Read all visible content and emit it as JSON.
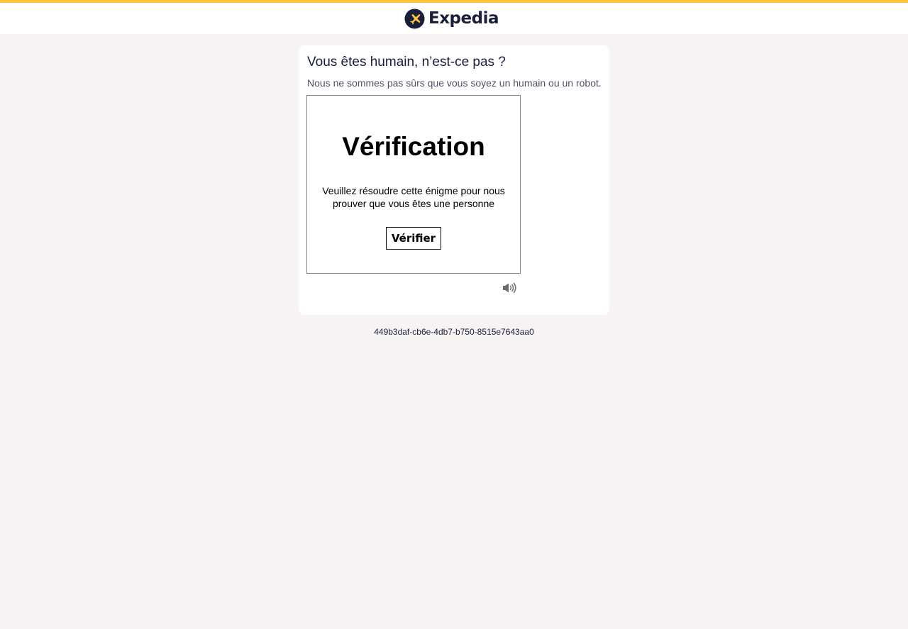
{
  "header": {
    "logo_text": "Expedia",
    "accent_color": "#fdc53a",
    "brand_color": "#191e3b",
    "logo_icon": "expedia-plane-icon"
  },
  "card": {
    "title": "Vous êtes humain, n’est-ce pas ?",
    "subtitle": "Nous ne sommes pas sûrs que vous soyez un humain ou un robot."
  },
  "challenge": {
    "heading": "Vérification",
    "instructions": "Veuillez résoudre cette énigme pour nous prouver que vous êtes une personne",
    "verify_label": "Vérifier",
    "audio_icon": "speaker-icon"
  },
  "footer": {
    "reference_id": "449b3daf-cb6e-4db7-b750-8515e7643aa0"
  }
}
